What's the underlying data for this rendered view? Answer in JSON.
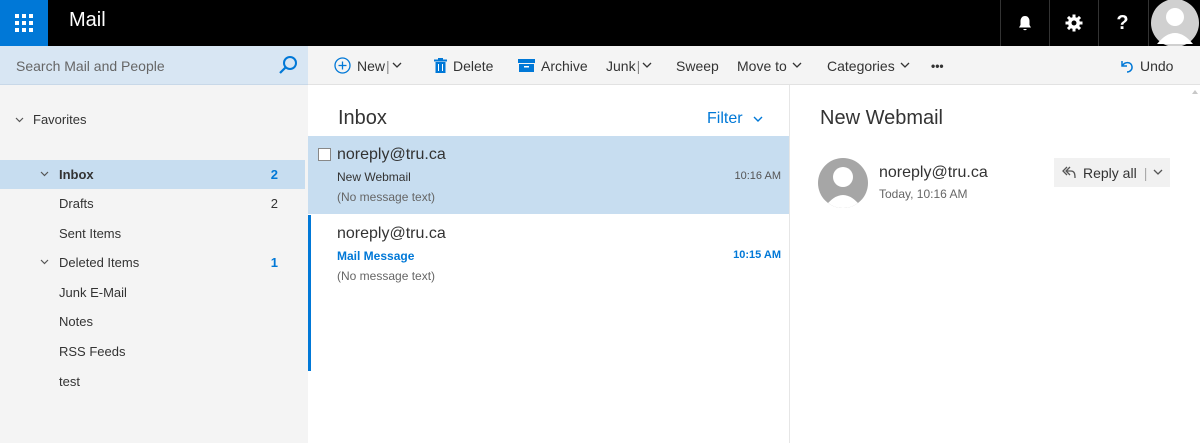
{
  "app": {
    "title": "Mail"
  },
  "search": {
    "placeholder": "Search Mail and People"
  },
  "toolbar": {
    "new_label": "New",
    "delete_label": "Delete",
    "archive_label": "Archive",
    "junk_label": "Junk",
    "sweep_label": "Sweep",
    "moveto_label": "Move to",
    "categories_label": "Categories",
    "more_label": "•••",
    "undo_label": "Undo"
  },
  "nav": {
    "favorites_label": "Favorites",
    "items": [
      {
        "label": "Inbox",
        "count": "2"
      },
      {
        "label": "Drafts",
        "count": "2"
      },
      {
        "label": "Sent Items",
        "count": ""
      },
      {
        "label": "Deleted Items",
        "count": "1"
      },
      {
        "label": "Junk E-Mail",
        "count": ""
      },
      {
        "label": "Notes",
        "count": ""
      },
      {
        "label": "RSS Feeds",
        "count": ""
      },
      {
        "label": "test",
        "count": ""
      }
    ]
  },
  "list": {
    "title": "Inbox",
    "filter_label": "Filter",
    "messages": [
      {
        "sender": "noreply@tru.ca",
        "subject": "New Webmail",
        "preview": "(No message text)",
        "time": "10:16 AM"
      },
      {
        "sender": "noreply@tru.ca",
        "subject": "Mail Message",
        "preview": "(No message text)",
        "time": "10:15 AM"
      }
    ]
  },
  "reading": {
    "title": "New Webmail",
    "sender": "noreply@tru.ca",
    "date": "Today, 10:16 AM",
    "reply_all_label": "Reply all"
  },
  "colors": {
    "accent": "#0078d7",
    "selected": "#c7ddf0",
    "topbar": "#000000"
  }
}
